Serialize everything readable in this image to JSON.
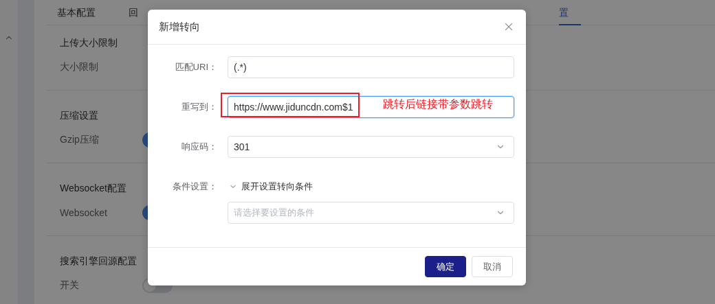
{
  "tabs": [
    {
      "label": "基本配置",
      "selected": false
    },
    {
      "label": "回",
      "selected": false
    },
    {
      "label": "置",
      "selected": true
    }
  ],
  "sections": [
    {
      "title": "上传大小限制",
      "setting": {
        "label": "大小限制",
        "kind": "text"
      }
    },
    {
      "title": "压缩设置",
      "setting": {
        "label": "Gzip压缩",
        "kind": "toggle",
        "on": true
      }
    },
    {
      "title": "Websocket配置",
      "setting": {
        "label": "Websocket",
        "kind": "toggle",
        "on": true
      }
    },
    {
      "title": "搜索引擎回源配置",
      "setting": {
        "label": "开关",
        "kind": "toggle",
        "on": false
      }
    }
  ],
  "dialog": {
    "title": "新增转向",
    "fields": [
      {
        "kind": "input",
        "label": "匹配URI：",
        "value": "(.*)",
        "focused": false
      },
      {
        "kind": "input",
        "label": "重写到：",
        "value": "https://www.jiduncdn.com$1",
        "focused": true
      },
      {
        "kind": "select",
        "label": "响应码：",
        "value": "301",
        "focused": false
      },
      {
        "kind": "condition",
        "label": "条件设置：",
        "toggle": "展开设置转向条件",
        "expanded": true,
        "placeholder": "请选择要设置的条件"
      }
    ],
    "buttons": [
      {
        "label": "确定",
        "kind": "primary"
      },
      {
        "label": "取消",
        "kind": "default"
      }
    ]
  },
  "annotation": {
    "text": "跳转后链接带参数跳转"
  }
}
